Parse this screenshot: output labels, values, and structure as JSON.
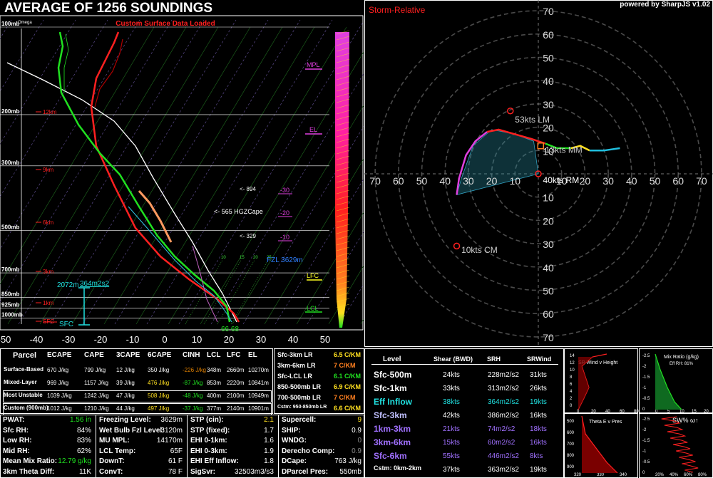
{
  "title": "AVERAGE OF 1256 SOUNDINGS",
  "powered": "powered by SharpJS v1.02",
  "custom_surface": "Custom Surface Data Loaded",
  "omega_label": "Omega",
  "colors": {
    "temp": "#ff2020",
    "dew": "#20e020",
    "parcel": "#ffffff",
    "wetbulb": "#30c0e0",
    "axis": "#ffffff",
    "isotherm": "#20a020",
    "dryadiabat": "#806020",
    "mixing": "#1f7a1f",
    "height": "#ff2020",
    "hodo_ring": "#3a3a3a",
    "accent_cyan": "#20e0e0",
    "violet": "#a070ff",
    "yellow": "#ffff20",
    "orange": "#ff8020",
    "magenta": "#e040e0"
  },
  "skewt": {
    "pressure_labels": [
      "100mb",
      "200mb",
      "300mb",
      "500mb",
      "700mb",
      "850mb",
      "925mb",
      "1000mb"
    ],
    "height_labels": [
      "12km",
      "9km",
      "6km",
      "3km",
      "1km",
      "SFC"
    ],
    "x_ticks": [
      "-50",
      "-40",
      "-30",
      "-20",
      "-10",
      "0",
      "10",
      "20",
      "30",
      "40",
      "50"
    ],
    "annotations": {
      "mpl": "MPL",
      "el": "EL",
      "lfc": "LFC",
      "lcl": "LCL",
      "t30": "-30",
      "t20": "-20",
      "t10": "-10",
      "a894": "<- 894",
      "hgzcape": "<- 565 HGZCape",
      "a329": "<- 329",
      "fzl": "FZL 3629m",
      "eff_bottom": "SFC",
      "eff_top": "2072m",
      "eff_srh": "364m2s2",
      "sfc_temps": "66 68",
      "mix_labels": [
        "10",
        "15",
        "20",
        "25"
      ]
    }
  },
  "hodograph": {
    "title": "Storm-Relative",
    "ring_labels": [
      "10",
      "20",
      "30",
      "40",
      "50",
      "60",
      "70"
    ],
    "x_labels": [
      "70",
      "60",
      "50",
      "40",
      "30",
      "20",
      "10",
      "10",
      "20",
      "30",
      "40",
      "50",
      "60",
      "70"
    ],
    "lm": "53kts LM",
    "mm": "13kts MM",
    "rm": "40kts RM",
    "cm": "10kts CM"
  },
  "parcel_table": {
    "headers": [
      "Parcel",
      "ECAPE",
      "CAPE",
      "3CAPE",
      "6CAPE",
      "CINH",
      "LCL",
      "LFC",
      "EL"
    ],
    "rows": [
      {
        "name": "Surface-Based",
        "ecape": "670 J/kg",
        "cape": "799 J/kg",
        "cape3": "12 J/kg",
        "cape6": "350 J/kg",
        "cinh": "-226 J/kg",
        "lcl": "348m",
        "lfc": "2660m",
        "el": "10270m"
      },
      {
        "name": "Mixed-Layer",
        "ecape": "969 J/kg",
        "cape": "1157 J/kg",
        "cape3": "39 J/kg",
        "cape6": "476 J/kg",
        "cinh": "-87 J/kg",
        "lcl": "853m",
        "lfc": "2220m",
        "el": "10841m"
      },
      {
        "name": "Most Unstable",
        "ecape": "1039 J/kg",
        "cape": "1242 J/kg",
        "cape3": "47 J/kg",
        "cape6": "508 J/kg",
        "cinh": "-48 J/kg",
        "lcl": "400m",
        "lfc": "2100m",
        "el": "10949m"
      },
      {
        "name": "Custom (900mb)",
        "ecape": "1012 J/kg",
        "cape": "1210 J/kg",
        "cape3": "44 J/kg",
        "cape6": "497 J/kg",
        "cinh": "-37 J/kg",
        "lcl": "377m",
        "lfc": "2140m",
        "el": "10901m"
      }
    ]
  },
  "lapse_rates": [
    {
      "label": "Sfc-3km LR",
      "value": "6.5 C/KM"
    },
    {
      "label": "3km-6km LR",
      "value": "7 C/KM"
    },
    {
      "label": "Sfc-LCL LR",
      "value": "6.1 C/KM"
    },
    {
      "label": "850-500mb LR",
      "value": "6.9 C/KM"
    },
    {
      "label": "700-500mb LR",
      "value": "7 C/KM"
    },
    {
      "label": "Cstm: 950-850mb LR",
      "value": "6.6 C/KM"
    }
  ],
  "kinematics": {
    "headers": [
      "Level",
      "Shear (BWD)",
      "SRH",
      "SRWind"
    ],
    "rows": [
      {
        "level": "Sfc-500m",
        "shear": "24kts",
        "srh": "228m2/s2",
        "srw": "31kts"
      },
      {
        "level": "Sfc-1km",
        "shear": "33kts",
        "srh": "313m2/s2",
        "srw": "26kts"
      },
      {
        "level": "Eff Inflow",
        "shear": "38kts",
        "srh": "364m2/s2",
        "srw": "19kts"
      },
      {
        "level": "Sfc-3km",
        "shear": "42kts",
        "srh": "386m2/s2",
        "srw": "16kts"
      },
      {
        "level": "1km-3km",
        "shear": "21kts",
        "srh": "74m2/s2",
        "srw": "18kts"
      },
      {
        "level": "3km-6km",
        "shear": "15kts",
        "srh": "60m2/s2",
        "srw": "16kts"
      },
      {
        "level": "Sfc-6km",
        "shear": "55kts",
        "srh": "446m2/s2",
        "srw": "8kts"
      },
      {
        "level": "Cstm: 0km-2km",
        "shear": "37kts",
        "srh": "363m2/s2",
        "srw": "19kts"
      }
    ]
  },
  "thermo": [
    {
      "label": "PWAT:",
      "value": "1.56 in"
    },
    {
      "label": "Sfc RH:",
      "value": "84%"
    },
    {
      "label": "Low RH:",
      "value": "83%"
    },
    {
      "label": "Mid RH:",
      "value": "62%"
    },
    {
      "label": "Mean Mix Ratio:",
      "value": "12.79 g/kg"
    },
    {
      "label": "3km Theta Diff:",
      "value": "11K"
    }
  ],
  "levels": [
    {
      "label": "Freezing Level:",
      "value": "3629m"
    },
    {
      "label": "Wet Bulb Fzl Level:",
      "value": "3120m"
    },
    {
      "label": "MU MPL:",
      "value": "14170m"
    },
    {
      "label": "LCL Temp:",
      "value": "65F"
    },
    {
      "label": "DownT:",
      "value": "61 F"
    },
    {
      "label": "ConvT:",
      "value": "78 F"
    }
  ],
  "composites1": [
    {
      "label": "STP (cin):",
      "value": "2.1"
    },
    {
      "label": "STP (fixed):",
      "value": "1.7"
    },
    {
      "label": "EHI 0-1km:",
      "value": "1.6"
    },
    {
      "label": "EHI 0-3km:",
      "value": "1.9"
    },
    {
      "label": "EHI Eff Inflow:",
      "value": "1.8"
    },
    {
      "label": "SigSvr:",
      "value": "32503m3/s3"
    }
  ],
  "composites2": [
    {
      "label": "Supercell:",
      "value": "9"
    },
    {
      "label": "SHIP:",
      "value": "0.9"
    },
    {
      "label": "WNDG:",
      "value": "0"
    },
    {
      "label": "Derecho Comp:",
      "value": "0.9"
    },
    {
      "label": "DCape:",
      "value": "763 J/kg"
    },
    {
      "label": "DParcel Pres:",
      "value": "550mb"
    }
  ],
  "insets": {
    "sr_wind": "SR Wind  v  Height",
    "mix_ratio": "Mix Ratio (g/kg)",
    "eff_rh": "Eff RH: 81%",
    "theta_e": "Theta E v Pres",
    "sw": "SW% ω↑",
    "sr_y": [
      "14",
      "12",
      "10",
      "8",
      "6",
      "4",
      "2",
      "0"
    ],
    "sr_x": [
      "0",
      "20",
      "40",
      "60",
      "80"
    ],
    "mix_y": [
      "-2.5",
      "-2",
      "-1.5",
      "-1",
      "-0.5",
      "0"
    ],
    "mix_x": [
      "0",
      "5",
      "10",
      "15",
      "20"
    ],
    "th_y": [
      "500",
      "600",
      "700",
      "800",
      "900"
    ],
    "th_x": [
      "320",
      "330",
      "340"
    ],
    "sw_y": [
      "-2.5",
      "-2",
      "-1.5",
      "-1",
      "-0.5",
      "0"
    ],
    "sw_x": [
      "20%",
      "40%",
      "60%",
      "80%"
    ]
  }
}
